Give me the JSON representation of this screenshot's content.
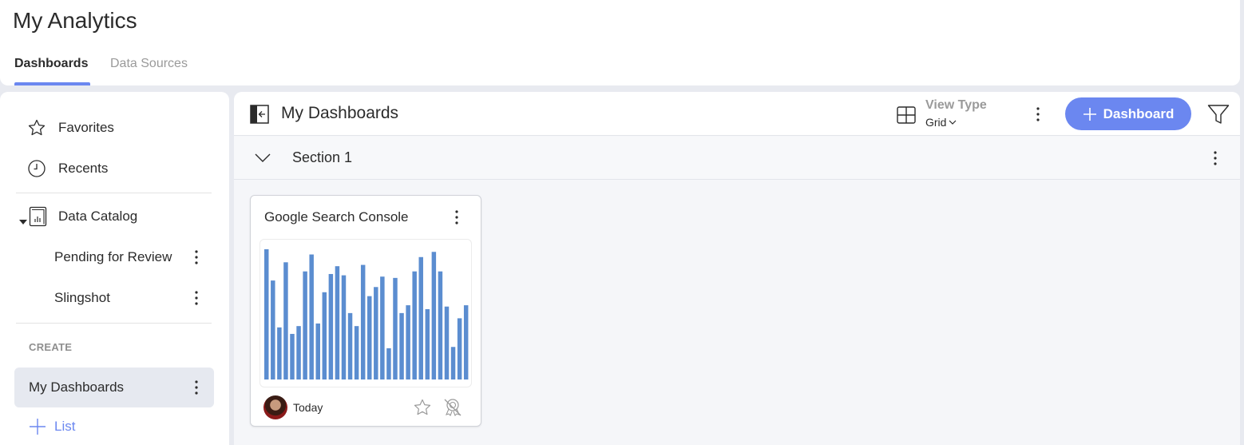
{
  "app": {
    "title": "My Analytics",
    "tabs": [
      {
        "label": "Dashboards",
        "active": true
      },
      {
        "label": "Data Sources",
        "active": false
      }
    ],
    "accent_color": "#6b87f0"
  },
  "sidebar": {
    "items": [
      {
        "label": "Favorites",
        "icon": "star-icon"
      },
      {
        "label": "Recents",
        "icon": "clock-icon"
      },
      {
        "label": "Data Catalog",
        "icon": "data-catalog-icon",
        "expanded": true
      }
    ],
    "catalog_children": [
      {
        "label": "Pending for Review"
      },
      {
        "label": "Slingshot"
      }
    ],
    "create_heading": "CREATE",
    "selected_item": {
      "label": "My Dashboards"
    },
    "add_list_label": "List"
  },
  "main": {
    "title": "My Dashboards",
    "view_type_label": "View Type",
    "view_type_value": "Grid",
    "add_button_label": "Dashboard",
    "section": {
      "title": "Section 1"
    },
    "cards": [
      {
        "title": "Google Search Console",
        "date": "Today",
        "favorite": false
      }
    ]
  },
  "chart_data": {
    "type": "bar",
    "title": "",
    "xlabel": "",
    "ylabel": "",
    "values": [
      100,
      76,
      40,
      90,
      35,
      41,
      83,
      96,
      43,
      67,
      81,
      87,
      80,
      51,
      41,
      88,
      64,
      71,
      79,
      24,
      78,
      51,
      57,
      83,
      94,
      54,
      98,
      83,
      56,
      25,
      47,
      57
    ],
    "ylim": [
      0,
      100
    ],
    "color": "#5b8dd0",
    "grid": false,
    "legend": "none"
  }
}
